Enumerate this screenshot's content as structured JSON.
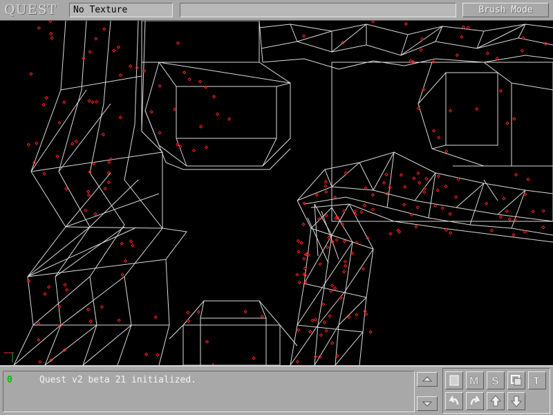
{
  "app": {
    "logo_text": "QUEST"
  },
  "toolbar": {
    "texture_label": "No Texture",
    "info_text": "",
    "mode_label": "Brush Mode"
  },
  "console": {
    "line_number": "0",
    "message": "Quest v2 beta 21 initialized."
  },
  "tools": [
    "new-brush-icon",
    "merge-icon",
    "split-icon",
    "copy-icon",
    "texture-icon",
    "undo-icon",
    "redo-icon",
    "move-up-icon",
    "move-down-icon"
  ],
  "colors": {
    "wireframe": "#ffffff",
    "vertex": "#ff2020",
    "background": "#000000",
    "panel": "#a8a8a8",
    "console_number": "#00c000"
  }
}
